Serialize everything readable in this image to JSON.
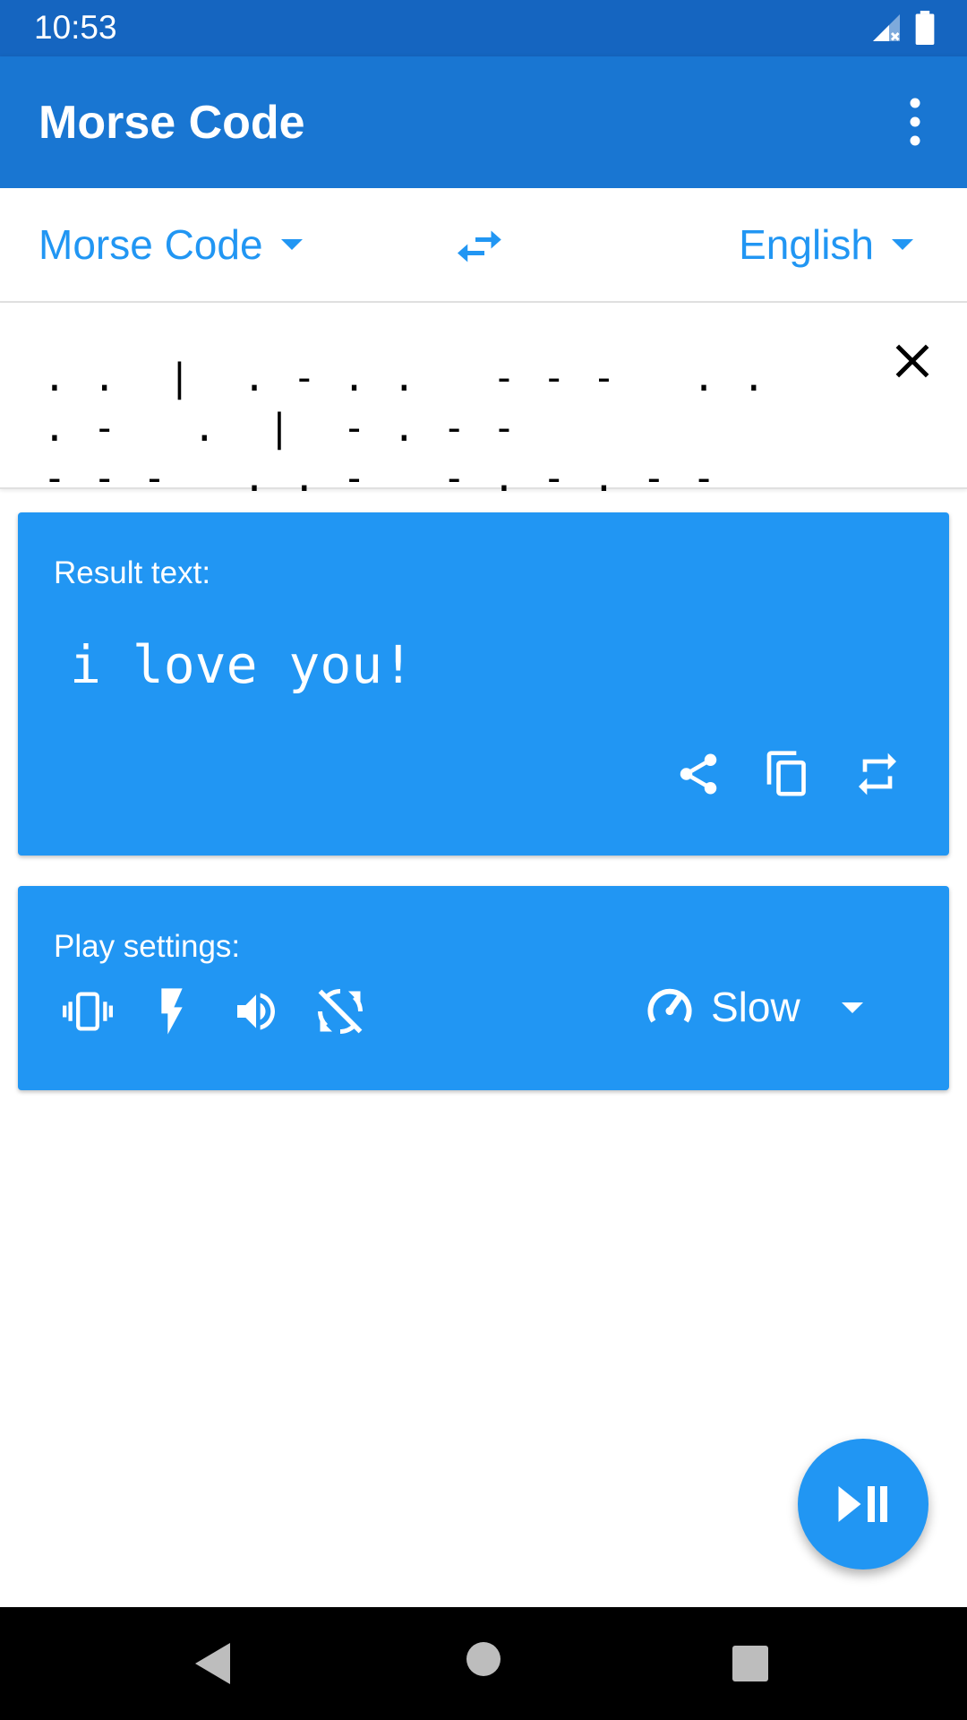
{
  "status_bar": {
    "time": "10:53",
    "icons": [
      "signal-icon",
      "battery-icon"
    ]
  },
  "app_bar": {
    "title": "Morse Code",
    "menu_icon": "more-vert-icon"
  },
  "language_bar": {
    "source": "Morse Code",
    "target": "English",
    "swap_icon": "swap-horiz-icon"
  },
  "input": {
    "text": ". .  |  . - . .   - - -   . . . -   .  |  - . - -\n- - -   . . -   - . - . - -"
  },
  "result": {
    "label": "Result text:",
    "text": "i love you!",
    "actions": [
      "share-icon",
      "copy-icon",
      "repeat-icon"
    ]
  },
  "play_settings": {
    "label": "Play settings:",
    "toggles": [
      "vibration-icon",
      "flash-icon",
      "volume-icon",
      "sync-disabled-icon"
    ],
    "speed": "Slow"
  },
  "fab": {
    "icon": "play-pause-icon"
  },
  "colors": {
    "status_bar": "#1565c0",
    "app_bar": "#1976d2",
    "accent": "#2196f3"
  }
}
